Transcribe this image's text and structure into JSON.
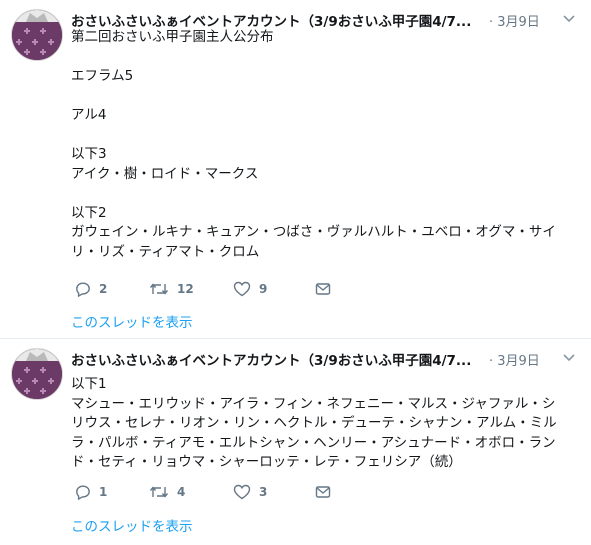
{
  "colors": {
    "link": "#1da1f2",
    "meta": "#657786",
    "text": "#14171a",
    "divider": "#e6ecf0",
    "avatar": "#6c3a66"
  },
  "tweets": [
    {
      "name": "おさいふさいふぁイベントアカウント（3/9おさいふ甲子園4/7...",
      "date": "· 3月9日",
      "lines": [
        "第二回おさいふ甲子園主人公分布",
        "",
        "エフラム5",
        "",
        "アル4",
        "",
        "以下3",
        "アイク・樹・ロイド・マークス",
        "",
        "以下2",
        "ガウェイン・ルキナ・キュアン・つばさ・ヴァルハルト・ユベロ・オグマ・サイ",
        "リ・リズ・ティアマト・クロム"
      ],
      "replies": "2",
      "retweets": "12",
      "likes": "9",
      "thread_link": "このスレッドを表示"
    },
    {
      "name": "おさいふさいふぁイベントアカウント（3/9おさいふ甲子園4/7...",
      "date": "· 3月9日",
      "lines": [
        "以下1",
        "マシュー・エリウッド・アイラ・フィン・ネフェニー・マルス・ジャファル・シ",
        "リウス・セレナ・リオン・リン・ヘクトル・デューテ・シャナン・アルム・ミル",
        "ラ・パルボ・ティアモ・エルトシャン・ヘンリー・アシュナード・オボロ・ラン",
        "ド・セティ・リョウマ・シャーロッテ・レテ・フェリシア（続）"
      ],
      "replies": "1",
      "retweets": "4",
      "likes": "3",
      "thread_link": "このスレッドを表示"
    }
  ]
}
